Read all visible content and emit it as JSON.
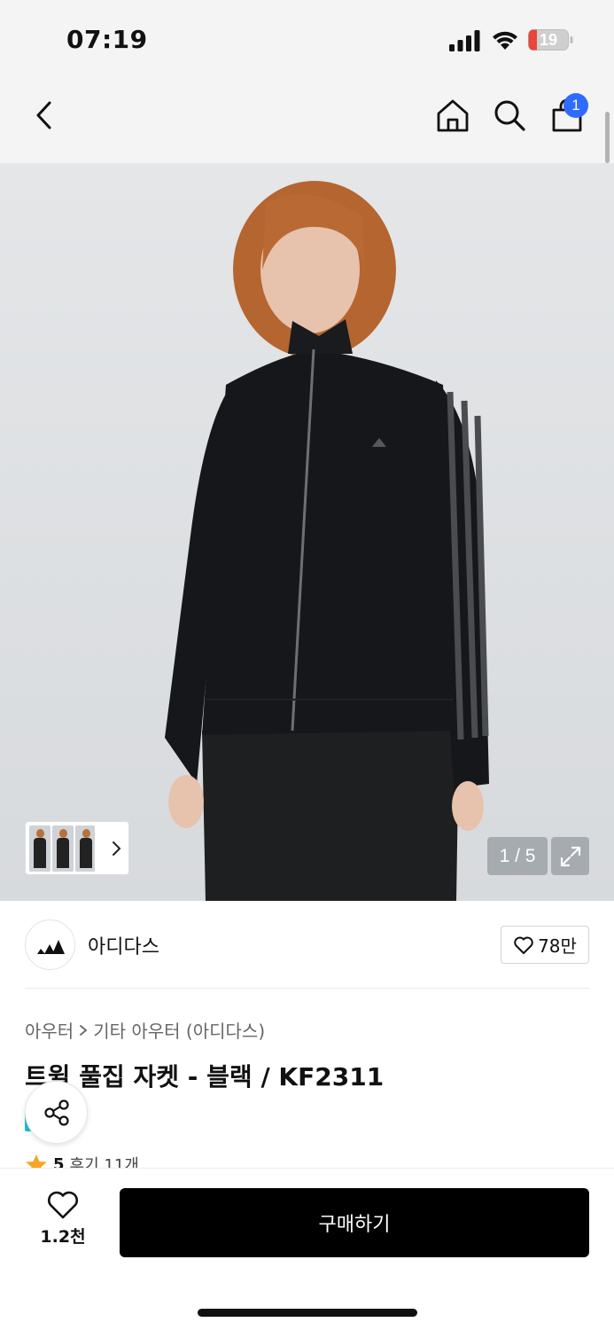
{
  "status_bar": {
    "time": "07:19",
    "battery_level": "19"
  },
  "nav": {
    "cart_count": "1"
  },
  "gallery": {
    "page_indicator": "1 / 5"
  },
  "brand": {
    "name": "아디다스",
    "like_count": "78만"
  },
  "breadcrumb": {
    "category": "아우터",
    "subcategory": "기타 아우터 (아디다스)"
  },
  "product": {
    "title": "트윌 풀집 자켓 - 블랙 / KF2311"
  },
  "rating": {
    "score": "5",
    "reviews": "후기 11개"
  },
  "bottom_bar": {
    "wish_count": "1.2천",
    "buy_label": "구매하기"
  },
  "colors": {
    "accent": "#2f6bff",
    "buy_button": "#000000",
    "teal_tag": "#1ec0d3",
    "rating_star": "#f5a623"
  },
  "icons": [
    "back-icon",
    "home-icon",
    "search-icon",
    "shopping-bag-icon",
    "expand-icon",
    "heart-icon",
    "share-icon",
    "star-icon",
    "chevron-right-icon",
    "adidas-logo-icon"
  ]
}
